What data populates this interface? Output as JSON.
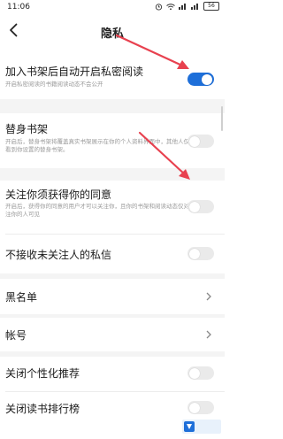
{
  "status_bar": {
    "time": "11:06",
    "battery": "56"
  },
  "nav": {
    "title": "隐私"
  },
  "settings": {
    "auto_private": {
      "title": "加入书架后自动开启私密阅读",
      "desc": "开启私密阅读的书籍阅读动态不会公开",
      "enabled": true
    },
    "substitute_shelf": {
      "title": "替身书架",
      "desc": "开启后，替身书架将覆盖真实书架展示在你的个人资料界面中，其他人仅能看到你设置的替身书架。",
      "enabled": false
    },
    "follow_consent": {
      "title": "关注你须获得你的同意",
      "desc": "开启后，获得你的同意的用户才可以关注你，且你的书架和阅读动态仅对关注你的人可见",
      "enabled": false
    },
    "block_messages": {
      "title": "不接收未关注人的私信",
      "enabled": false
    },
    "blacklist": {
      "title": "黑名单"
    },
    "account": {
      "title": "帐号"
    },
    "personalized": {
      "title": "关闭个性化推荐",
      "enabled": false
    },
    "ranking": {
      "title": "关闭读书排行榜",
      "enabled": false
    }
  },
  "colors": {
    "accent": "#1e6fd9",
    "annotation": "#e8414f"
  },
  "icons": {
    "back": "back-arrow-icon",
    "chevron": "chevron-right-icon"
  }
}
